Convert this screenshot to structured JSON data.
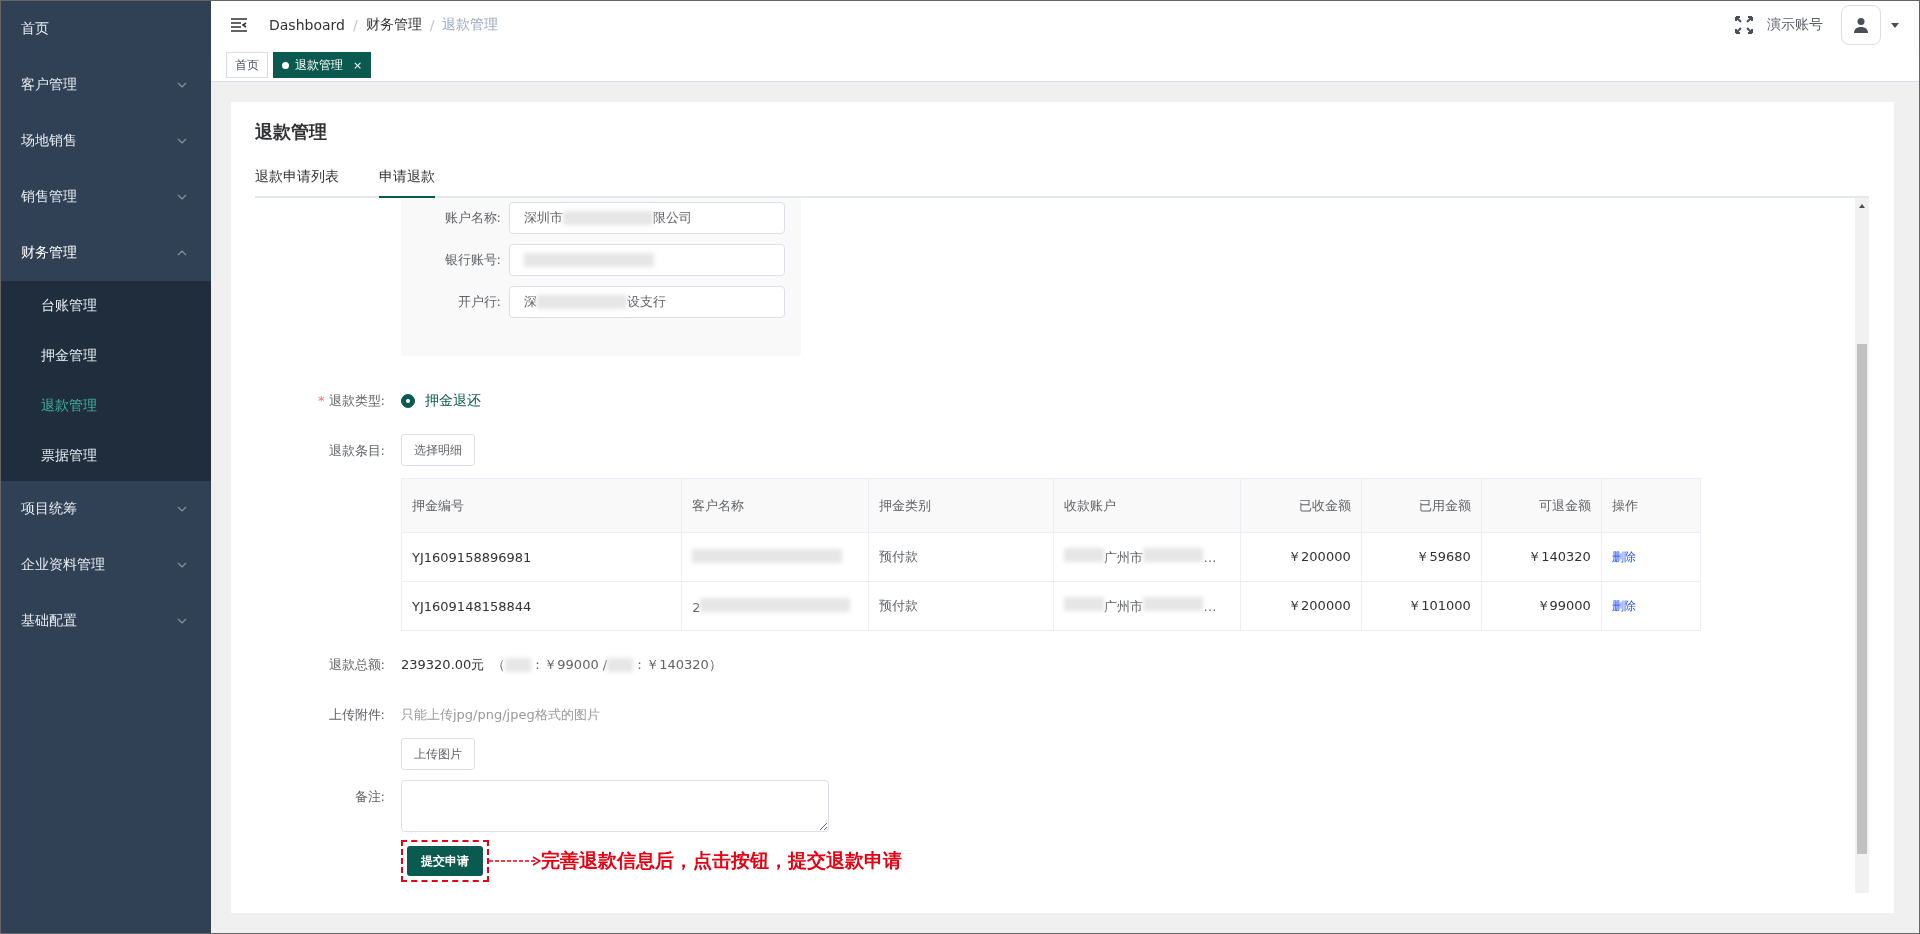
{
  "sidebar": {
    "items": [
      {
        "label": "首页"
      },
      {
        "label": "客户管理",
        "expanded": false
      },
      {
        "label": "场地销售",
        "expanded": false
      },
      {
        "label": "销售管理",
        "expanded": false
      },
      {
        "label": "财务管理",
        "expanded": true,
        "children": [
          {
            "label": "台账管理",
            "selected": false
          },
          {
            "label": "押金管理",
            "selected": false
          },
          {
            "label": "退款管理",
            "selected": true
          },
          {
            "label": "票据管理",
            "selected": false
          }
        ]
      },
      {
        "label": "项目统筹",
        "expanded": false
      },
      {
        "label": "企业资料管理",
        "expanded": false
      },
      {
        "label": "基础配置",
        "expanded": false
      }
    ]
  },
  "header": {
    "breadcrumb": [
      "Dashboard",
      "财务管理",
      "退款管理"
    ],
    "separator": "/",
    "account": "演示账号"
  },
  "tags": [
    {
      "label": "首页",
      "selected": false
    },
    {
      "label": "退款管理",
      "selected": true,
      "close": "×"
    }
  ],
  "page": {
    "title": "退款管理",
    "tabs": [
      {
        "label": "退款申请列表",
        "selected": false
      },
      {
        "label": "申请退款",
        "selected": true
      }
    ]
  },
  "bank": [
    {
      "label": "账户名称:",
      "value_start": "深圳市",
      "value_end": "限公司"
    },
    {
      "label": "银行账号:"
    },
    {
      "label": "开户行:",
      "value_start": "深",
      "value_end": "设支行"
    }
  ],
  "refund_type": {
    "label": "退款类型:",
    "required": true,
    "required_mark": "*",
    "options": [
      {
        "label": "押金退还",
        "selected": true
      }
    ]
  },
  "items": {
    "label": "退款条目:",
    "button": "选择明细",
    "columns": [
      "押金编号",
      "客户名称",
      "押金类别",
      "收款账户",
      "已收金额",
      "已用金额",
      "可退金额",
      "操作"
    ],
    "rows": [
      {
        "id": "YJ1609158896981",
        "type": "预付款",
        "account": "广州市",
        "account_end": "…",
        "received": "￥200000",
        "used": "￥59680",
        "refundable": "￥140320",
        "action": "删除"
      },
      {
        "id": "YJ1609148158844",
        "customer": "2",
        "type": "预付款",
        "account": "广州市",
        "account_end": "…",
        "received": "￥200000",
        "used": "￥101000",
        "refundable": "￥99000",
        "action": "删除"
      }
    ]
  },
  "total": {
    "label": "退款总额:",
    "amount": "239320.00元",
    "parts": [
      "（",
      "：￥99000 / ",
      "：￥140320）"
    ]
  },
  "upload": {
    "label": "上传附件:",
    "hint": "只能上传jpg/png/jpeg格式的图片",
    "button": "上传图片"
  },
  "remark": {
    "label": "备注:"
  },
  "submit": "提交申请",
  "annotation": "完善退款信息后，点击按钮，提交退款申请"
}
